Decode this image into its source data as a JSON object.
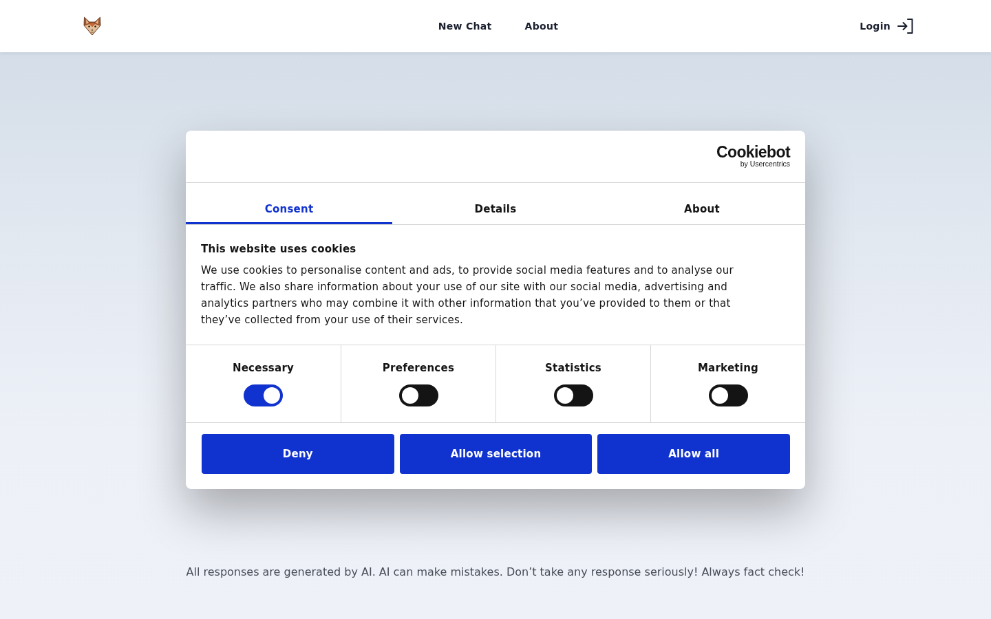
{
  "header": {
    "nav": [
      {
        "label": "New Chat"
      },
      {
        "label": "About"
      }
    ],
    "login": "Login"
  },
  "cookie_dialog": {
    "brand": {
      "name": "Cookiebot",
      "byline": "by Usercentrics"
    },
    "tabs": [
      {
        "label": "Consent",
        "selected": true
      },
      {
        "label": "Details",
        "selected": false
      },
      {
        "label": "About",
        "selected": false
      }
    ],
    "title": "This website uses cookies",
    "body": "We use cookies to personalise content and ads, to provide social media features and to analyse our traffic. We also share information about your use of our site with our social media, advertising and analytics partners who may combine it with other information that you’ve provided to them or that they’ve collected from your use of their services.",
    "categories": [
      {
        "label": "Necessary",
        "on": true
      },
      {
        "label": "Preferences",
        "on": false
      },
      {
        "label": "Statistics",
        "on": false
      },
      {
        "label": "Marketing",
        "on": false
      }
    ],
    "buttons": [
      "Deny",
      "Allow selection",
      "Allow all"
    ]
  },
  "disclaimer": "All responses are generated by AI. AI can make mistakes. Don’t take any response seriously! Always fact check!"
}
